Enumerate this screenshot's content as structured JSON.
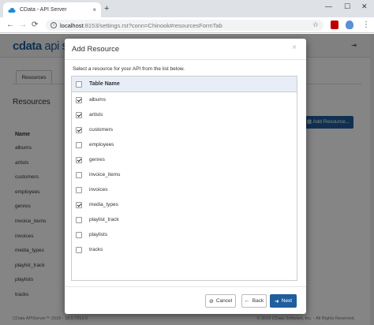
{
  "browser": {
    "tab_title": "CData - API Server",
    "tab_close": "×",
    "new_tab": "+",
    "url_host": "localhost",
    "url_rest": ":8153/settings.rst?conn=Chinook#resourcesFormTab",
    "minimize": "—",
    "maximize": "☐",
    "close": "✕",
    "back": "←",
    "forward": "→",
    "reload": "⟳",
    "star": "☆",
    "menu": "⋮",
    "icons": [
      "cloud-icon",
      "info-icon",
      "star-icon",
      "pdf-icon",
      "shield-icon",
      "menu-icon"
    ]
  },
  "app": {
    "logo_brand": "cdata",
    "logo_suffix": " api s",
    "logout_glyph": "⇥",
    "tab_label": "Resources",
    "heading": "Resources",
    "add_button": "Add Resource...",
    "name_header": "Name",
    "resources": [
      "albums",
      "artists",
      "customers",
      "employees",
      "genres",
      "invoice_items",
      "invoices",
      "media_types",
      "playlist_track",
      "playlists",
      "tracks"
    ],
    "footer_left": "CData APIServer™ 2018 - 18.0.7012.0",
    "footer_right": "© 2019 CData Software, Inc. - All Rights Reserved."
  },
  "modal": {
    "title": "Add Resource",
    "close": "×",
    "description": "Select a resource for your API from the list below.",
    "table_header": "Table Name",
    "rows": [
      {
        "name": "albums",
        "checked": true
      },
      {
        "name": "artists",
        "checked": true
      },
      {
        "name": "customers",
        "checked": true
      },
      {
        "name": "employees",
        "checked": false
      },
      {
        "name": "genres",
        "checked": true
      },
      {
        "name": "invoice_items",
        "checked": false
      },
      {
        "name": "invoices",
        "checked": false
      },
      {
        "name": "media_types",
        "checked": true
      },
      {
        "name": "playlist_track",
        "checked": false
      },
      {
        "name": "playlists",
        "checked": false
      },
      {
        "name": "tracks",
        "checked": false
      }
    ],
    "cancel_label": "Cancel",
    "back_label": "Back",
    "next_label": "Next",
    "colors": {
      "accent": "#1f5d9e",
      "header_row": "#e8eef7"
    }
  }
}
